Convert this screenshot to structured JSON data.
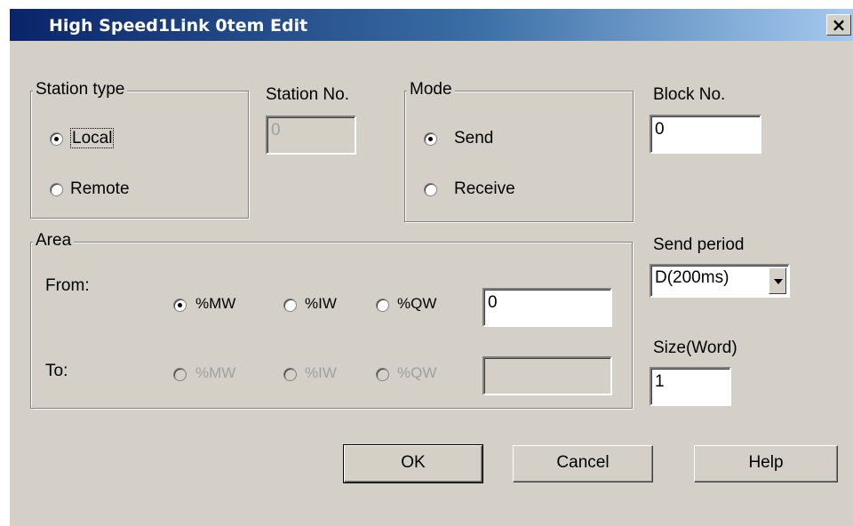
{
  "window": {
    "title": "High Speed1Link  0tem   Edit",
    "close_glyph": "×"
  },
  "station_type": {
    "group_label": "Station type",
    "options": [
      {
        "label": "Local",
        "selected": true
      },
      {
        "label": "Remote",
        "selected": false
      }
    ]
  },
  "station_no": {
    "label": "Station No.",
    "value": "0",
    "enabled": false
  },
  "mode": {
    "group_label": "Mode",
    "options": [
      {
        "label": "Send",
        "selected": true
      },
      {
        "label": "Receive",
        "selected": false
      }
    ]
  },
  "block_no": {
    "label": "Block No.",
    "value": "0"
  },
  "area": {
    "group_label": "Area",
    "from": {
      "label": "From:",
      "options": [
        {
          "label": "%MW",
          "selected": true
        },
        {
          "label": "%IW",
          "selected": false
        },
        {
          "label": "%QW",
          "selected": false
        }
      ],
      "value": "0"
    },
    "to": {
      "label": "To:",
      "enabled": false,
      "options": [
        {
          "label": "%MW",
          "selected": false
        },
        {
          "label": "%IW",
          "selected": false
        },
        {
          "label": "%QW",
          "selected": false
        }
      ],
      "value": ""
    }
  },
  "send_period": {
    "label": "Send period",
    "value": "D(200ms)"
  },
  "size_word": {
    "label": "Size(Word)",
    "value": "1"
  },
  "buttons": {
    "ok": "OK",
    "cancel": "Cancel",
    "help": "Help"
  }
}
